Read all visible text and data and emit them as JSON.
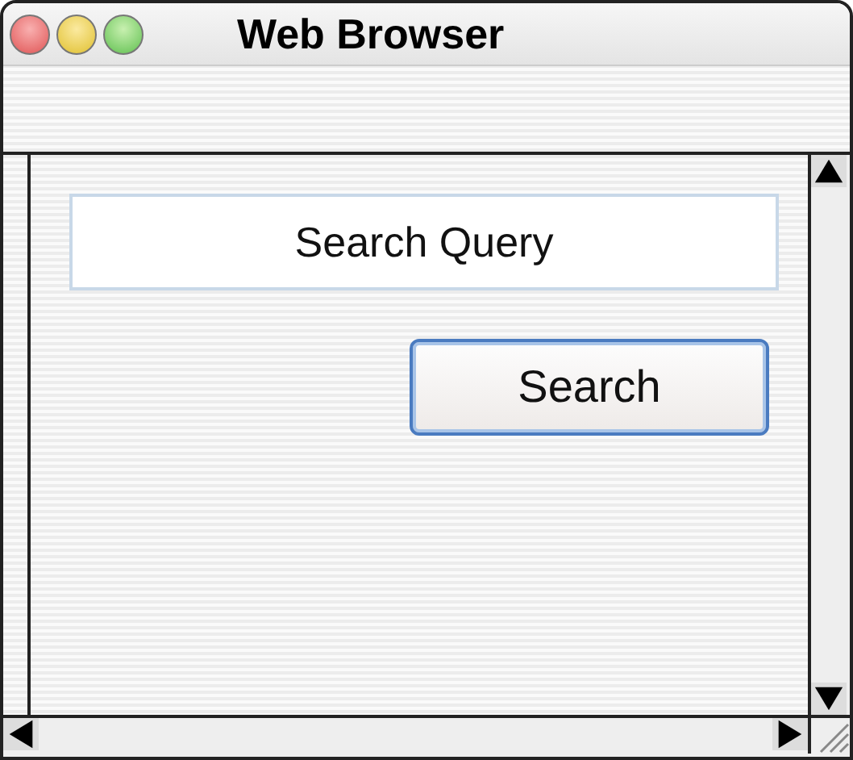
{
  "window": {
    "title": "Web Browser"
  },
  "search_field": {
    "placeholder": "Search Query"
  },
  "search_button": {
    "label": "Search"
  }
}
